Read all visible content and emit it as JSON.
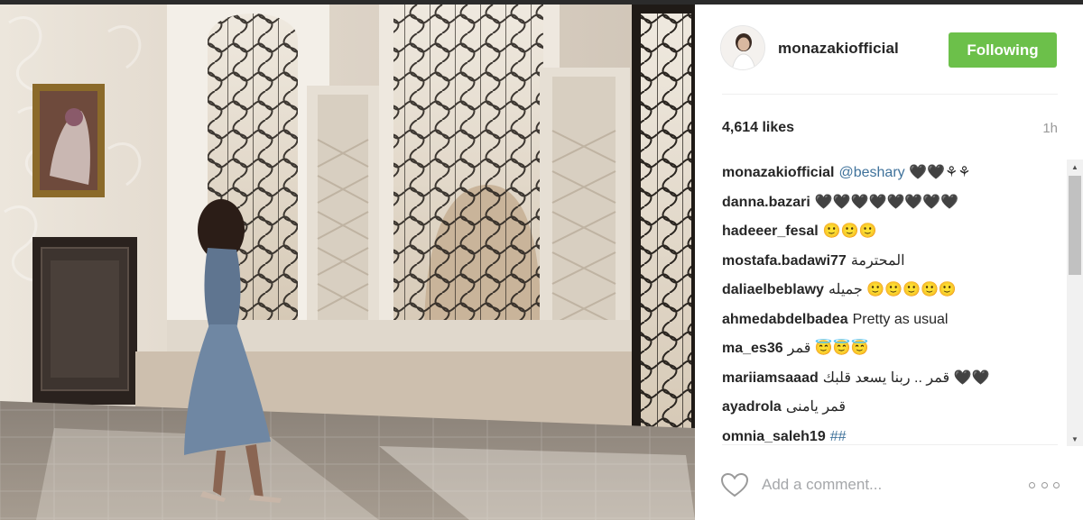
{
  "post": {
    "image_alt": "",
    "author": "monazakiofficial",
    "follow_label": "Following",
    "likes": "4,614 likes",
    "time_ago": "1h"
  },
  "comments": [
    {
      "user": "monazakiofficial",
      "mention": "@beshary",
      "text": " 🖤🖤⚘⚘"
    },
    {
      "user": "danna.bazari",
      "text": "🖤🖤🖤🖤🖤🖤🖤🖤"
    },
    {
      "user": "hadeeer_fesal",
      "text": "🙂🙂🙂"
    },
    {
      "user": "mostafa.badawi77",
      "text": "المحترمة"
    },
    {
      "user": "daliaelbeblawy",
      "text": "جميله 🙂🙂🙂🙂🙂"
    },
    {
      "user": "ahmedabdelbadea",
      "text": "Pretty as usual"
    },
    {
      "user": "ma_es36",
      "text": "قمر 😇😇😇"
    },
    {
      "user": "mariiamsaaad",
      "text": "قمر .. ربنا يسعد قلبك 🖤🖤"
    },
    {
      "user": "ayadrola",
      "text": "قمر يامنى"
    },
    {
      "user": "omnia_saleh19",
      "hashtag": "##"
    }
  ],
  "footer": {
    "comment_placeholder": "Add a comment...",
    "like_icon": "heart-outline-icon",
    "more_icon": "more-options-icon"
  },
  "colors": {
    "follow_button": "#6cc04a",
    "mention": "#3f729b",
    "divider": "#efefef"
  }
}
